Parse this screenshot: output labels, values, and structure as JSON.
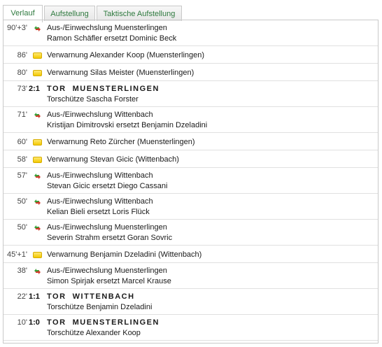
{
  "tabs": [
    {
      "label": "Verlauf",
      "active": true
    },
    {
      "label": "Aufstellung",
      "active": false
    },
    {
      "label": "Taktische Aufstellung",
      "active": false
    }
  ],
  "colors": {
    "tab_text": "#2f7a3f",
    "card_yellow": "#f3c900",
    "border": "#c9c9c9"
  },
  "events": [
    {
      "minute": "90'+3'",
      "icon": "substitution-icon",
      "line1": "Aus-/Einwechslung Muensterlingen",
      "line2": "Ramon Schäfler ersetzt Dominic Beck"
    },
    {
      "minute": "86'",
      "icon": "yellow-card-icon",
      "line1": "Verwarnung Alexander Koop (Muensterlingen)"
    },
    {
      "minute": "80'",
      "icon": "yellow-card-icon",
      "line1": "Verwarnung Silas Meister (Muensterlingen)"
    },
    {
      "minute": "73'",
      "score": "2:1",
      "goal_title": "TOR  MUENSTERLINGEN",
      "line2": "Torschütze Sascha Forster"
    },
    {
      "minute": "71'",
      "icon": "substitution-icon",
      "line1": "Aus-/Einwechslung Wittenbach",
      "line2": "Kristijan Dimitrovski ersetzt Benjamin Dzeladini"
    },
    {
      "minute": "60'",
      "icon": "yellow-card-icon",
      "line1": "Verwarnung Reto Zürcher (Muensterlingen)"
    },
    {
      "minute": "58'",
      "icon": "yellow-card-icon",
      "line1": "Verwarnung Stevan Gicic (Wittenbach)"
    },
    {
      "minute": "57'",
      "icon": "substitution-icon",
      "line1": "Aus-/Einwechslung Wittenbach",
      "line2": "Stevan Gicic ersetzt Diego Cassani"
    },
    {
      "minute": "50'",
      "icon": "substitution-icon",
      "line1": "Aus-/Einwechslung Wittenbach",
      "line2": "Kelian Bieli ersetzt Loris Flück"
    },
    {
      "minute": "50'",
      "icon": "substitution-icon",
      "line1": "Aus-/Einwechslung Muensterlingen",
      "line2": "Severin Strahm ersetzt Goran Sovric"
    },
    {
      "minute": "45'+1'",
      "icon": "yellow-card-icon",
      "line1": "Verwarnung Benjamin Dzeladini (Wittenbach)"
    },
    {
      "minute": "38'",
      "icon": "substitution-icon",
      "line1": "Aus-/Einwechslung Muensterlingen",
      "line2": "Simon Spirjak ersetzt Marcel Krause"
    },
    {
      "minute": "22'",
      "score": "1:1",
      "goal_title": "TOR  WITTENBACH",
      "line2": "Torschütze Benjamin Dzeladini"
    },
    {
      "minute": "10'",
      "score": "1:0",
      "goal_title": "TOR  MUENSTERLINGEN",
      "line2": "Torschütze Alexander Koop"
    }
  ]
}
